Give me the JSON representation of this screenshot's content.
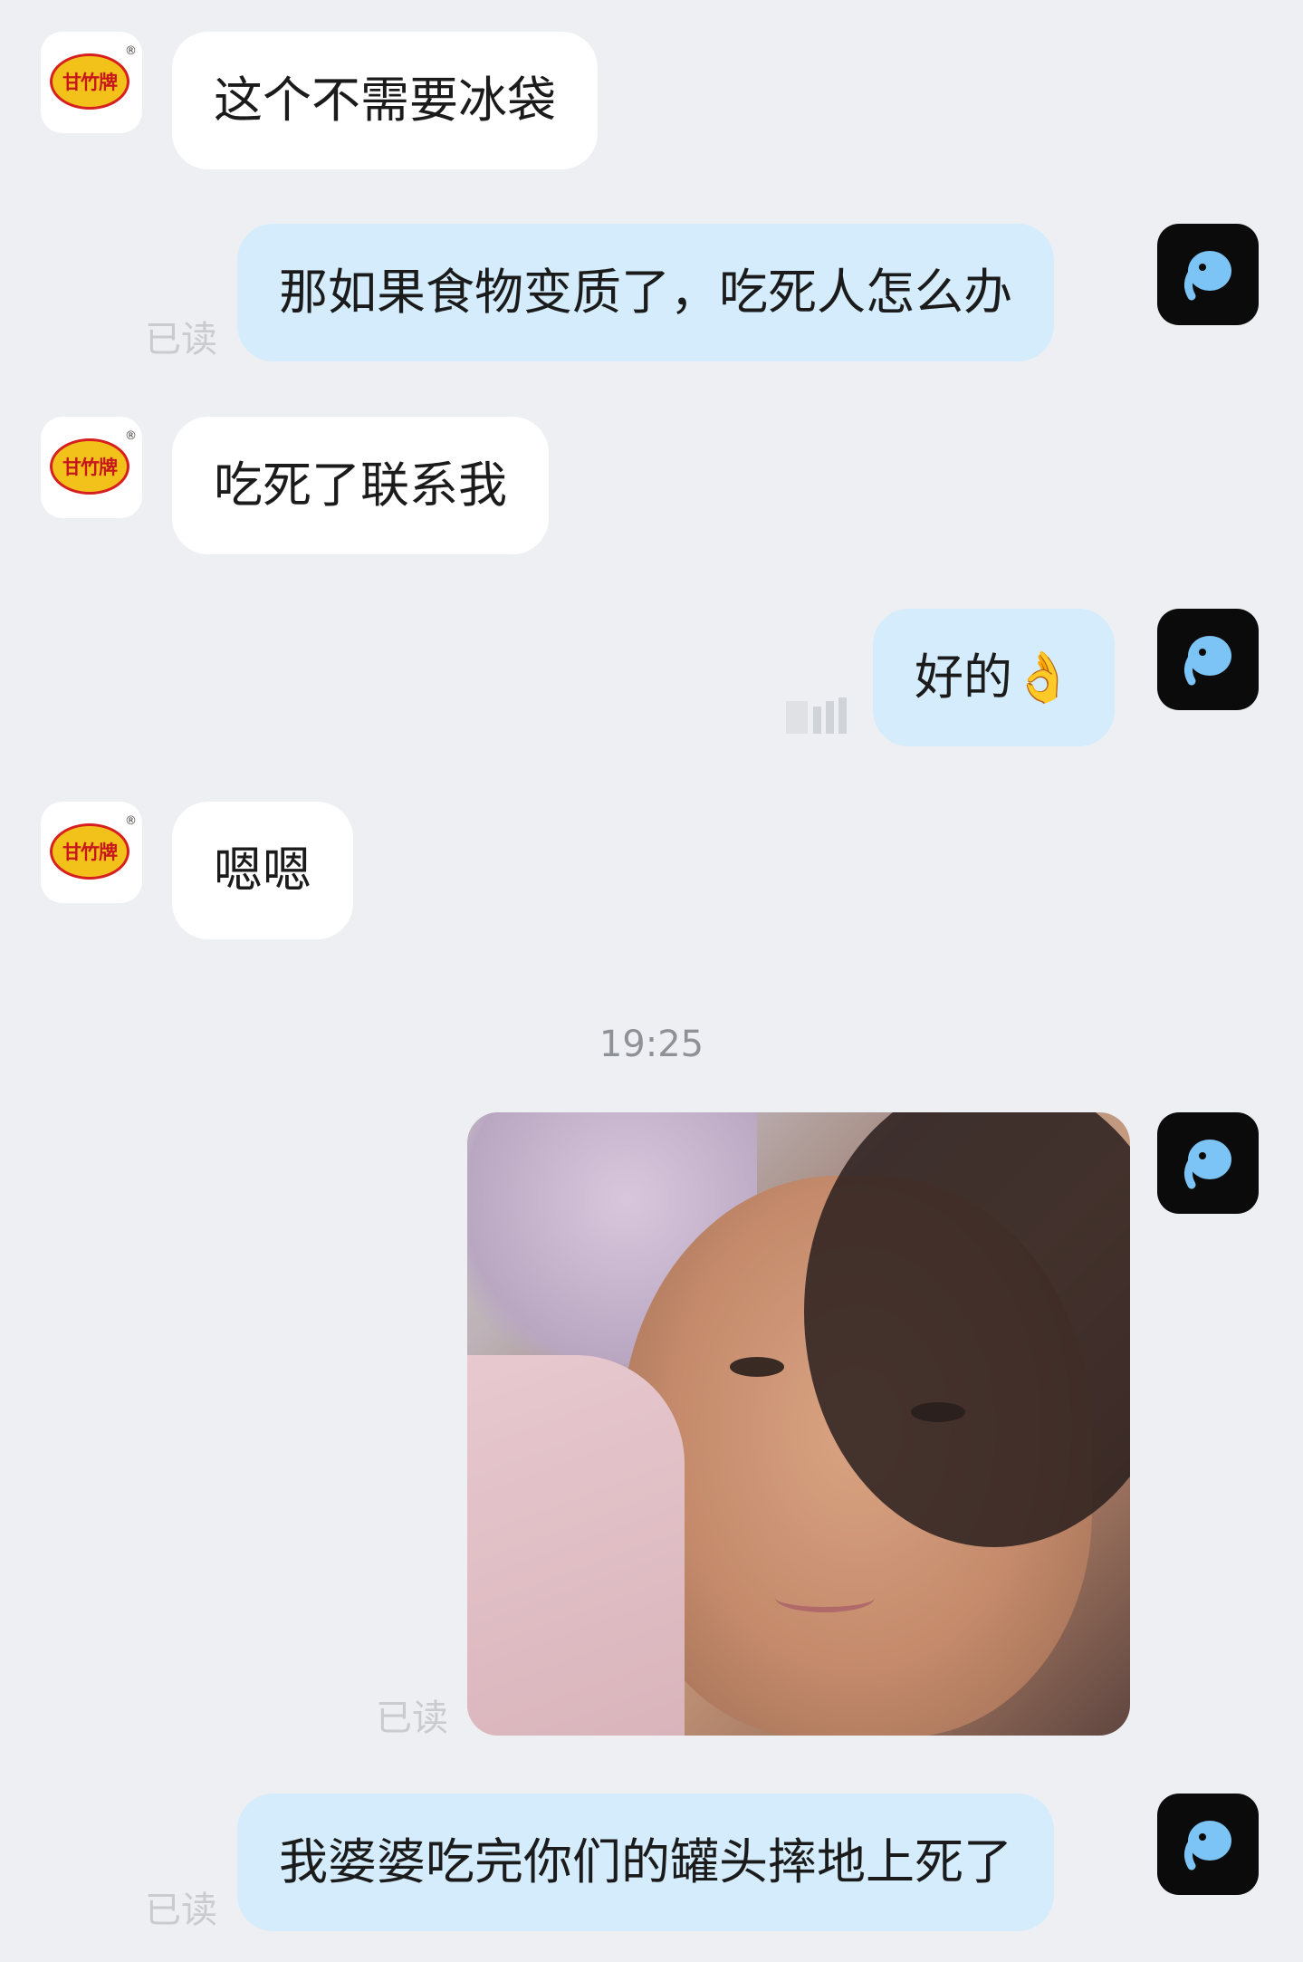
{
  "messages": [
    {
      "from": "shop",
      "text": "这个不需要冰袋"
    },
    {
      "from": "user",
      "text": "那如果食物变质了，吃死人怎么办",
      "status": "已读"
    },
    {
      "from": "shop",
      "text": "吃死了联系我"
    },
    {
      "from": "user",
      "text": "好的👌"
    },
    {
      "from": "shop",
      "text": "嗯嗯"
    },
    {
      "from": "user",
      "type": "image",
      "status": "已读"
    },
    {
      "from": "user",
      "text": "我婆婆吃完你们的罐头摔地上死了",
      "status": "已读"
    }
  ],
  "timestamp": "19:25",
  "shop_avatar": {
    "logo_text": "甘竹牌",
    "reg_mark": "®",
    "colors": {
      "fill": "#f2c21b",
      "ring": "#d81f1f",
      "text": "#c8161d"
    }
  },
  "user_avatar": {
    "icon": "elephant-icon",
    "colors": {
      "bg": "#0b0b0b",
      "icon": "#7cc4f5"
    }
  },
  "colors": {
    "background": "#eeeff3",
    "incoming_bubble": "#ffffff",
    "outgoing_bubble": "#d4ecfb",
    "read_status": "#c9cbcf"
  }
}
